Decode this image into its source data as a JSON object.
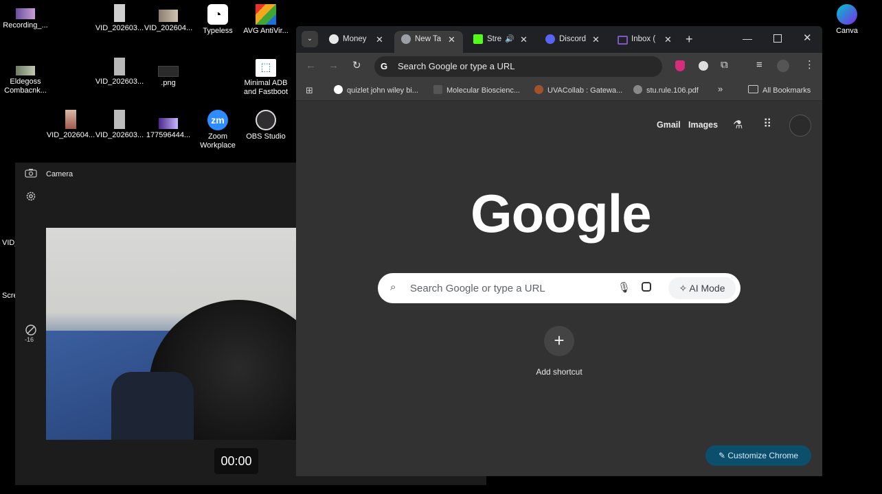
{
  "desktop": {
    "icons": [
      {
        "name": "recording-icon",
        "label": "Recording_..."
      },
      {
        "name": "vid-1-icon",
        "label": "VID_202603..."
      },
      {
        "name": "vid-2-icon",
        "label": "VID_202604..."
      },
      {
        "name": "typeless-icon",
        "label": "Typeless"
      },
      {
        "name": "avg-icon",
        "label": "AVG AntiVir..."
      },
      {
        "name": "eldegoss-icon",
        "label": "Eldegoss Combacnk..."
      },
      {
        "name": "vid-3-icon",
        "label": "VID_202603..."
      },
      {
        "name": "png-icon",
        "label": ".png"
      },
      {
        "name": "minimal-adb-icon",
        "label": "Minimal ADB and Fastboot"
      },
      {
        "name": "vid-4-icon",
        "label": "VID_202604..."
      },
      {
        "name": "vid-5-icon",
        "label": "VID_202603..."
      },
      {
        "name": "file-177-icon",
        "label": "177596444..."
      },
      {
        "name": "zoom-icon",
        "label": "Zoom Workplace"
      },
      {
        "name": "obs-icon",
        "label": "OBS Studio"
      },
      {
        "name": "canva-icon",
        "label": "Canva"
      }
    ],
    "partial_labels": [
      "VID_",
      "Scre"
    ]
  },
  "camera": {
    "title": "Camera",
    "exposure_value": "-16",
    "timer": "00:00"
  },
  "chrome": {
    "tabs": [
      {
        "label": "Money",
        "fav": "#e8e8e8"
      },
      {
        "label": "New Ta",
        "fav": "#9aa0a6"
      },
      {
        "label": "Stre",
        "fav": "#53fc18"
      },
      {
        "label": "Discord",
        "fav": "#5865f2"
      },
      {
        "label": "Inbox (",
        "fav": "#7e57c2"
      }
    ],
    "omnibox": "Search Google or type a URL",
    "bookmarks": [
      {
        "label": "quizlet john wiley bi...",
        "fav": "#ffffff"
      },
      {
        "label": "Molecular Bioscienc...",
        "fav": "#555555"
      },
      {
        "label": "UVACollab : Gatewa...",
        "fav": "#a0522d"
      },
      {
        "label": "stu.rule.106.pdf",
        "fav": "#888888"
      }
    ],
    "all_bookmarks": "All Bookmarks",
    "ntp": {
      "gmail": "Gmail",
      "images": "Images",
      "logo": "Google",
      "search_placeholder": "Search Google or type a URL",
      "ai_mode": "AI Mode",
      "add_shortcut": "Add shortcut",
      "customize": "Customize Chrome"
    }
  }
}
